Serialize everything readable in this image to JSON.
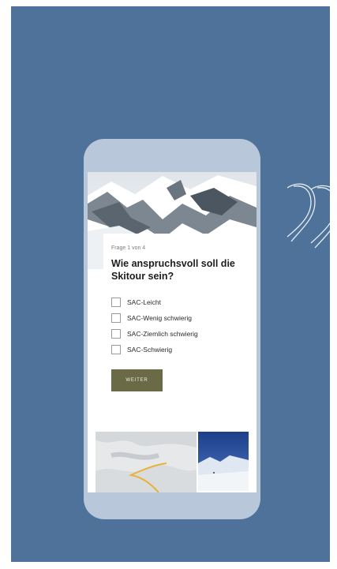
{
  "colors": {
    "stage_background": "#4f729a",
    "phone_frame": "#b8c8da",
    "button_background": "#6a6a46",
    "button_text": "#f4f1e6"
  },
  "quiz": {
    "step": "Frage 1 von 4",
    "question": "Wie anspruchsvoll soll die Skitour sein?",
    "options": [
      {
        "label": "SAC-Leicht",
        "checked": false
      },
      {
        "label": "SAC-Wenig schwierig",
        "checked": false
      },
      {
        "label": "SAC-Ziemlich schwierig",
        "checked": false
      },
      {
        "label": "SAC-Schwierig",
        "checked": false
      }
    ],
    "next_label": "WEITER"
  },
  "icons": {
    "decoration": "quote-mark-outline-icon"
  }
}
